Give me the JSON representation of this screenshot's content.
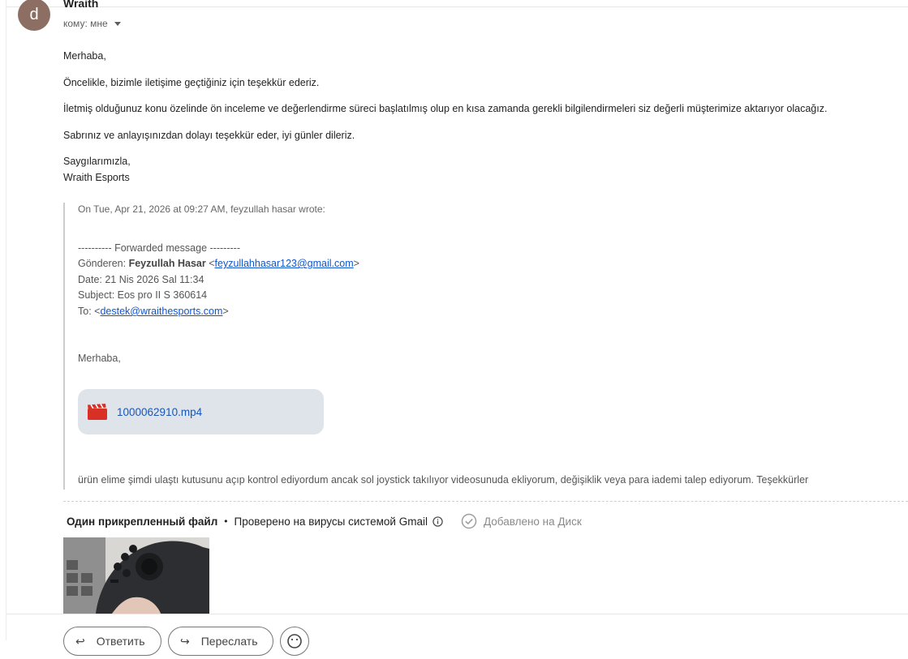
{
  "message": {
    "avatar_letter": "d",
    "sender": "Wraith",
    "recipient": "кому: мне",
    "body": [
      "Merhaba,",
      "Öncelikle, bizimle iletişime geçtiğiniz için teşekkür ederiz.",
      "İletmiş olduğunuz konu özelinde ön inceleme ve değerlendirme süreci başlatılmış olup en kısa zamanda gerekli bilgilendirmeleri siz değerli müşterimize aktarıyor olacağız.",
      "Sabrınız ve anlayışınızdan dolayı teşekkür eder, iyi günler dileriz.",
      "Saygılarımızla,",
      "Wraith Esports"
    ]
  },
  "quoted": {
    "header": "On Tue, Apr 21, 2026 at 09:27 AM, feyzullah hasar wrote:",
    "forwarded": "---------- Forwarded message ---------",
    "from_label": "Gönderen:",
    "from_name": "Feyzullah Hasar",
    "from_email": "feyzullahhasar123@gmail.com",
    "date_line": "Date: 21 Nis 2026 Sal 11:34",
    "subject_line": "Subject: Eos pro II S 360614",
    "to_label": "To:",
    "to_email": "destek@wraithesports.com",
    "greeting": "Merhaba,",
    "attachment_name": "1000062910.mp4",
    "closing": "ürün elime şimdi ulaştı kutusunu açıp kontrol ediyordum ancak sol joystick takılıyor videosunuda ekliyorum, değişiklik veya para iademi talep ediyorum. Teşekkürler"
  },
  "attachments_bar": {
    "title": "Один прикрепленный файл",
    "separator": "•",
    "scan": "Проверено на вирусы системой Gmail",
    "drive": "Добавлено на Диск"
  },
  "actions": {
    "reply": "Ответить",
    "forward": "Переслать"
  },
  "colors": {
    "avatar": "#8d6e63",
    "link": "#1155cc",
    "chip_bg": "#dfe3ea",
    "video_icon": "#d93025"
  },
  "icons": [
    "video-file-icon",
    "info-icon",
    "drive-check-icon",
    "reply-arrow-icon",
    "forward-arrow-icon",
    "emoji-icon"
  ]
}
